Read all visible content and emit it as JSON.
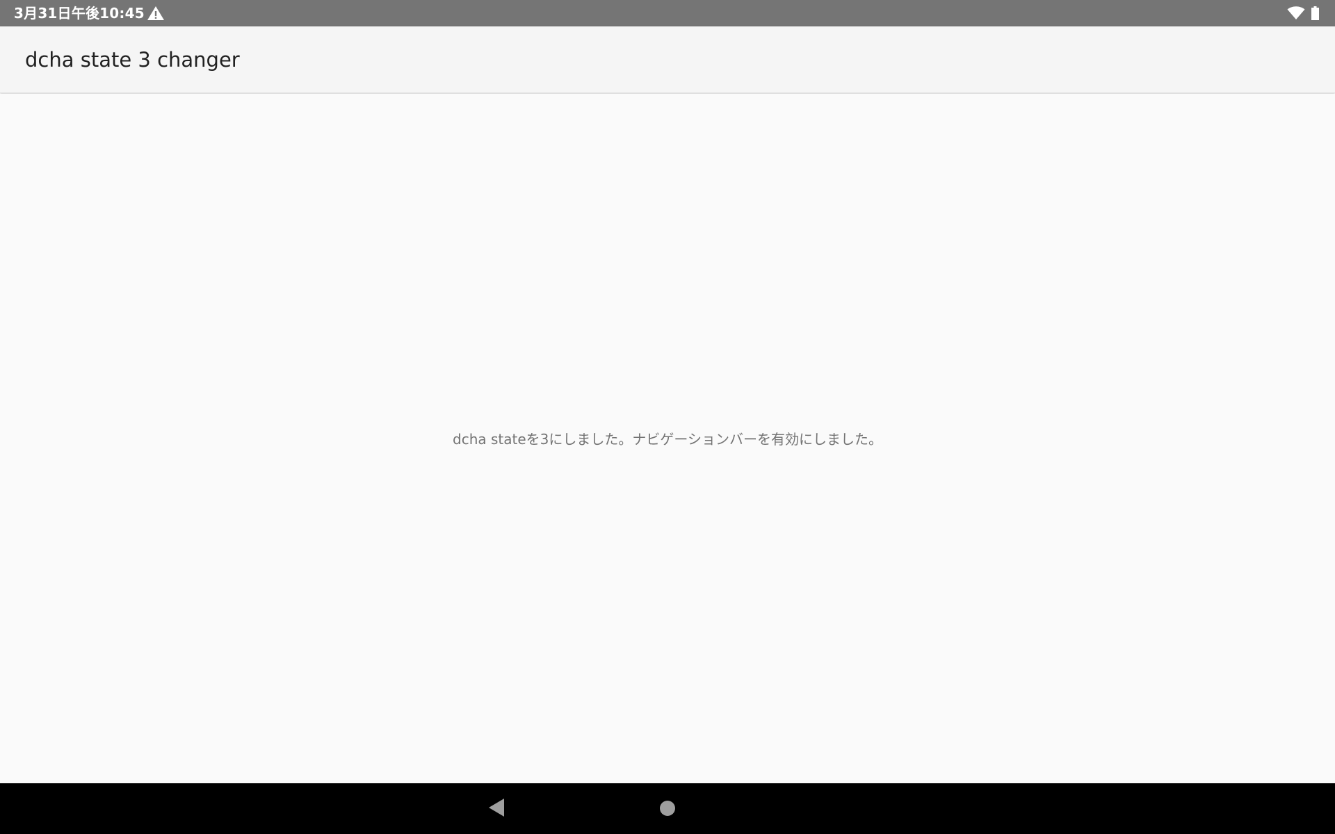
{
  "status_bar": {
    "time": "3月31日午後10:45",
    "icons": [
      "warning-icon",
      "wifi-icon",
      "battery-icon"
    ],
    "background": "#757575"
  },
  "app_bar": {
    "title": "dcha state 3 changer",
    "background": "#f5f5f5"
  },
  "content": {
    "message": "dcha stateを3にしました。ナビゲーションバーを有効にしました。"
  },
  "nav_bar": {
    "buttons": [
      "back-icon",
      "home-icon"
    ],
    "background": "#000000"
  }
}
